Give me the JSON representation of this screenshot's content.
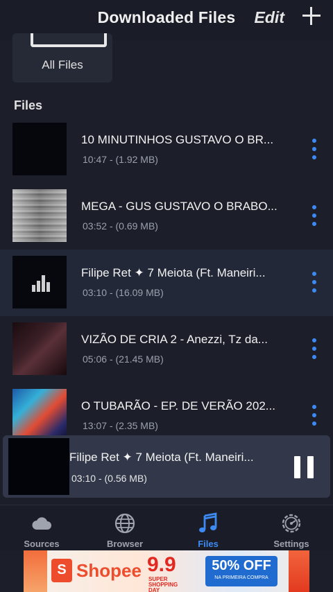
{
  "header": {
    "title": "Downloaded Files",
    "edit_label": "Edit",
    "add_icon": "plus-icon"
  },
  "folders": [
    {
      "label": "All Files",
      "icon": "folder-icon"
    }
  ],
  "files_section": {
    "title": "Files"
  },
  "files": [
    {
      "name": "10 MINUTINHOS GUSTAVO O BR...",
      "duration": "10:47",
      "size": "(1.92 MB)"
    },
    {
      "name": "MEGA - GUS GUSTAVO O BRABO...",
      "duration": "03:52",
      "size": "(0.69 MB)"
    },
    {
      "name": "Filipe Ret ✦ 7 Meiota (Ft. Maneiri...",
      "duration": "03:10",
      "size": "(16.09 MB)"
    },
    {
      "name": "VIZÃO DE CRIA 2 - Anezzi, Tz da...",
      "duration": "05:06",
      "size": "(21.45 MB)"
    },
    {
      "name": "O TUBARÃO - EP. DE VERÃO 202...",
      "duration": "13:07",
      "size": "(2.35 MB)"
    }
  ],
  "meta_separator": "-",
  "now_playing": {
    "name": "Filipe Ret ✦ 7 Meiota (Ft. Maneiri...",
    "duration": "03:10",
    "size": "(0.56 MB)",
    "control_icon": "pause-icon"
  },
  "tabs": [
    {
      "label": "Sources",
      "icon": "cloud-icon",
      "active": false
    },
    {
      "label": "Browser",
      "icon": "globe-icon",
      "active": false
    },
    {
      "label": "Files",
      "icon": "music-note-icon",
      "active": true
    },
    {
      "label": "Settings",
      "icon": "gear-icon",
      "active": false
    }
  ],
  "ad": {
    "brand": "Shopee",
    "bag_letter": "S",
    "promo_number": "9.9",
    "promo_text": "SUPER SHOPPING DAY",
    "discount": "50% OFF",
    "discount_note": "NA PRIMEIRA COMPRA"
  },
  "colors": {
    "accent": "#3d8bf2",
    "background": "#1c1f2a",
    "player_bg": "#323849"
  }
}
